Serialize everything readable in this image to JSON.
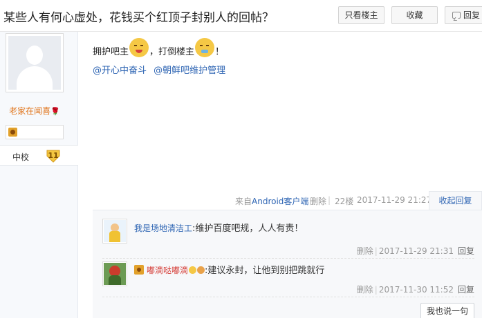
{
  "header": {
    "title": "某些人有何心虚处，花钱买个红顶子封别人的回帖？",
    "buttons": {
      "only_op": "只看楼主",
      "favorite": "收藏",
      "reply": "回复"
    }
  },
  "author": {
    "name": "老家在闻喜",
    "rank": "中校",
    "level": "11"
  },
  "post": {
    "text_a": "拥护吧主",
    "text_b": "，打倒楼主",
    "text_c": "！",
    "mentions": [
      "@开心中奋斗",
      "@朝鲜吧维护管理"
    ]
  },
  "post_footer": {
    "source_prefix": "来自",
    "source_client": "Android客户端",
    "delete": "删除",
    "floor": "22楼",
    "time": "2017-11-29 21:27",
    "collapse": "收起回复"
  },
  "comments": [
    {
      "user": "我是场地清洁工",
      "text": ":维护百度吧规，人人有责！",
      "delete": "删除",
      "time": "2017-11-29 21:31",
      "reply": "回复"
    },
    {
      "user": "嘟滴哒嘟滴",
      "text": ":建议永封，让他到别把跳就行",
      "delete": "删除",
      "time": "2017-11-30 11:52",
      "reply": "回复"
    }
  ],
  "say_button": "我也说一句",
  "colors": {
    "link": "#2d64b3",
    "author_name": "#e0741a",
    "comment_user_red": "#d6403a"
  }
}
